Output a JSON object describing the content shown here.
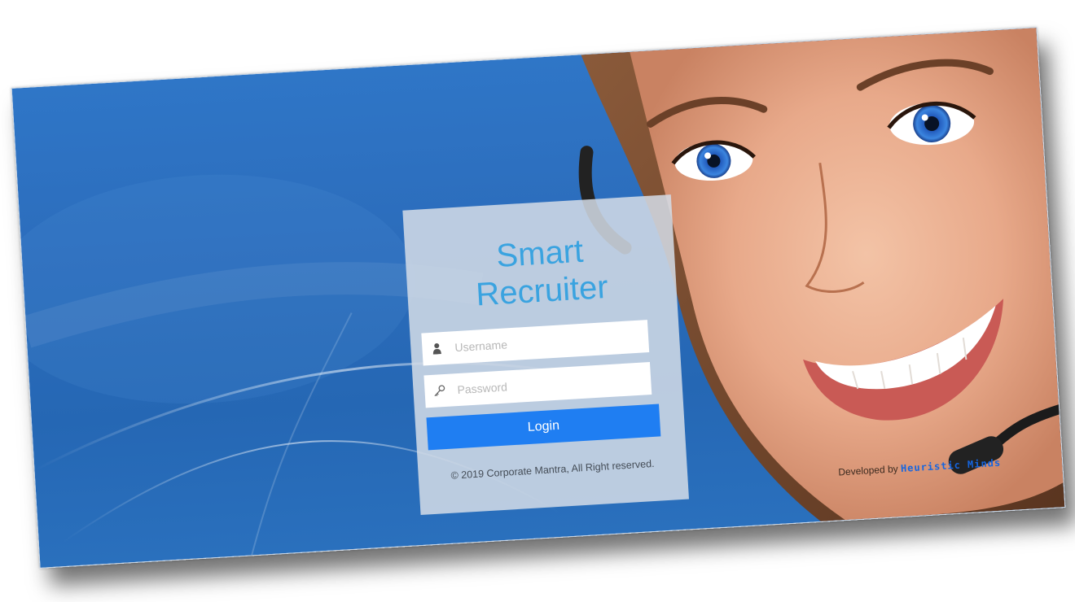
{
  "app": {
    "title_line1": "Smart",
    "title_line2": "Recruiter"
  },
  "form": {
    "username_placeholder": "Username",
    "password_placeholder": "Password",
    "login_label": "Login"
  },
  "footer": {
    "copyright": "© 2019 Corporate Mantra, All Right reserved.",
    "developed_by_prefix": "Developed by ",
    "developer_brand": "Heuristic Minds"
  },
  "icons": {
    "username": "user-icon",
    "password": "key-icon"
  },
  "colors": {
    "background": "#2c6dbc",
    "title": "#3aa3e0",
    "login_button": "#1f7ef2",
    "brand_text": "#1565e0"
  }
}
